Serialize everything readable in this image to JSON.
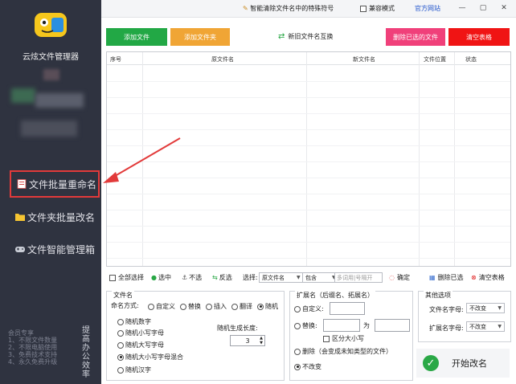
{
  "sidebar": {
    "app_name": "云炫文件管理器",
    "nav": [
      {
        "label": "文件批量重命名"
      },
      {
        "label": "文件夹批量改名"
      },
      {
        "label": "文件智能管理箱"
      }
    ],
    "promo_lines": [
      "会员专享",
      "1、不限文件数量",
      "2、不限电脑使用",
      "3、免费技术支持",
      "4、永久免费升级"
    ],
    "promo_vertical": [
      "提",
      "高",
      "办",
      "公",
      "效",
      "率"
    ]
  },
  "titlebar": {
    "special_chars": "智能清除文件名中的特殊符号",
    "compat_mode": "兼容模式",
    "official_site": "官方网站",
    "min": "—",
    "max": "▢",
    "close": "✕"
  },
  "toolbar": {
    "add_file": "添加文件",
    "add_folder": "添加文件夹",
    "swap": "新旧文件名互换",
    "delete_selected": "删除已选的文件",
    "clear_table": "清空表格"
  },
  "table": {
    "columns": [
      "序号",
      "原文件名",
      "新文件名",
      "文件位置",
      "状态"
    ]
  },
  "selection": {
    "select_all": "全部选择",
    "select": "选中",
    "deselect": "不选",
    "invert": "反选",
    "choose_label": "选择:",
    "field_value": "原文件名",
    "match_value": "包含",
    "keyword_placeholder": "多词用|号隔开",
    "confirm": "确定",
    "delete_selected": "删除已选",
    "clear_table": "清空表格"
  },
  "filename_panel": {
    "title": "文件名",
    "mode_label": "命名方式:",
    "modes": [
      "自定义",
      "替换",
      "插入",
      "翻译",
      "随机"
    ],
    "random_options": [
      "随机数字",
      "随机小写字母",
      "随机大写字母",
      "随机大小写字母混合",
      "随机汉字"
    ],
    "length_label": "随机生成长度:",
    "length_value": "3"
  },
  "ext_panel": {
    "title": "扩展名（后缀名、拓展名）",
    "custom": "自定义:",
    "replace": "替换:",
    "to": "为",
    "case_sensitive": "区分大小写",
    "delete": "删除（会变成未知类型的文件）",
    "unchanged": "不改变"
  },
  "other_panel": {
    "title": "其他选项",
    "filename_case_label": "文件名字母:",
    "filename_case_value": "不改变",
    "ext_case_label": "扩展名字母:",
    "ext_case_value": "不改变"
  },
  "start_button": "开始改名",
  "colors": {
    "sidebar_bg": "#2f3340",
    "highlight_red": "#e23a3a",
    "green": "#22a845",
    "orange": "#f0a535",
    "pink": "#f0407a",
    "red": "#f01414"
  }
}
